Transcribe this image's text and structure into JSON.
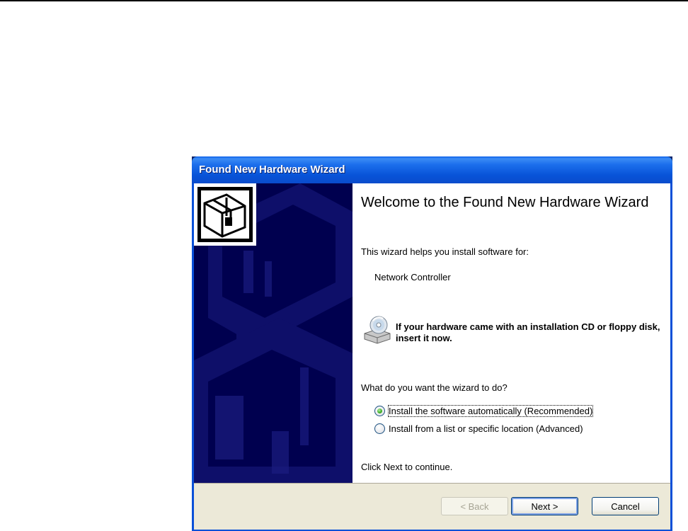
{
  "window": {
    "title": "Found New Hardware Wizard"
  },
  "content": {
    "heading": "Welcome to the Found New Hardware Wizard",
    "intro": "This wizard helps you install software for:",
    "device": "Network Controller",
    "cd_message": "If your hardware came with an installation CD or floppy disk, insert it now.",
    "question": "What do you want the wizard to do?",
    "options": [
      {
        "label": "Install the software automatically (Recommended)",
        "selected": true
      },
      {
        "label": "Install from a list or specific location (Advanced)",
        "selected": false
      }
    ],
    "continue_text": "Click Next to continue."
  },
  "buttons": {
    "back": "< Back",
    "next": "Next >",
    "cancel": "Cancel"
  },
  "icons": {
    "wizard": "hardware-box-icon",
    "cd": "cd-drive-icon"
  },
  "colors": {
    "titlebar": "#0a5ee8",
    "side_panel": "#00004f",
    "footer": "#ece9d8",
    "radio_selected": "#41b02a"
  }
}
